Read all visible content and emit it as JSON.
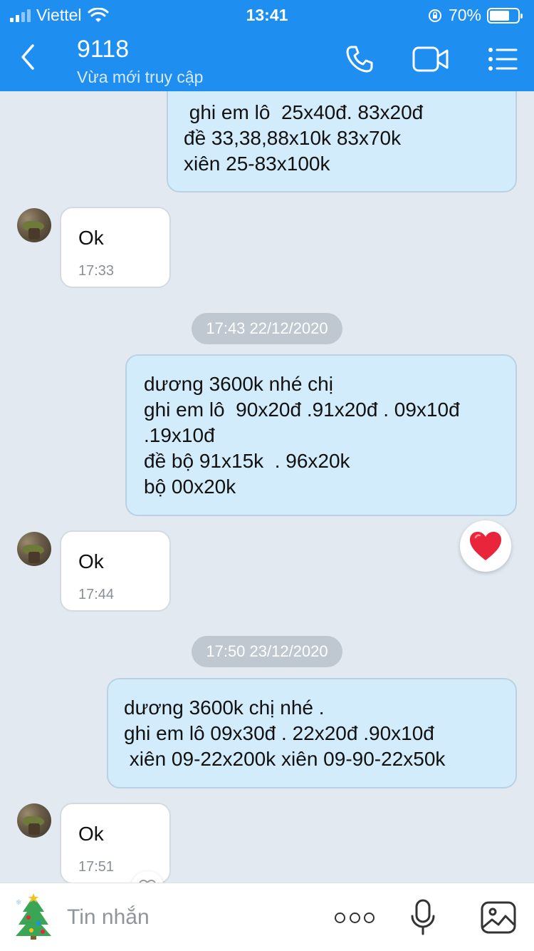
{
  "status_bar": {
    "carrier": "Viettel",
    "time": "13:41",
    "battery": "70%",
    "battery_level": 0.7
  },
  "header": {
    "contact_name": "9118",
    "contact_status": "Vừa mới truy cập",
    "icons": [
      "back-icon",
      "phone-icon",
      "video-call-icon",
      "menu-icon"
    ]
  },
  "messages": {
    "m1": {
      "direction": "out",
      "text": " ghi em lô  25x40đ. 83x20đ\nđề 33,38,88x10k 83x70k\nxiên 25-83x100k"
    },
    "m2": {
      "direction": "in",
      "text": "Ok",
      "time": "17:33"
    },
    "d1": "17:43 22/12/2020",
    "m3": {
      "direction": "out",
      "text": "dương 3600k nhé chị\nghi em lô  90x20đ .91x20đ . 09x10đ\n.19x10đ\nđề bộ 91x15k  . 96x20k\nbộ 00x20k",
      "reaction": "heart-icon"
    },
    "m4": {
      "direction": "in",
      "text": "Ok",
      "time": "17:44"
    },
    "d2": "17:50 23/12/2020",
    "m5": {
      "direction": "out",
      "text": "dương 3600k chị nhé .\nghi em lô 09x30đ . 22x20đ .90x10đ\n xiên 09-22x200k xiên 09-90-22x50k"
    },
    "m6": {
      "direction": "in",
      "text": "Ok",
      "time": "17:51"
    }
  },
  "input_bar": {
    "placeholder": "Tin nhắn",
    "icons": [
      "sticker-icon",
      "more-icon",
      "microphone-icon",
      "image-icon"
    ]
  },
  "colors": {
    "header": "#1f8ef1",
    "chat_bg": "#e2e9f1",
    "outgoing_bubble": "#d3ecfb",
    "incoming_bubble": "#ffffff",
    "date_chip": "#bfc8d1",
    "heart": "#e8253a"
  }
}
